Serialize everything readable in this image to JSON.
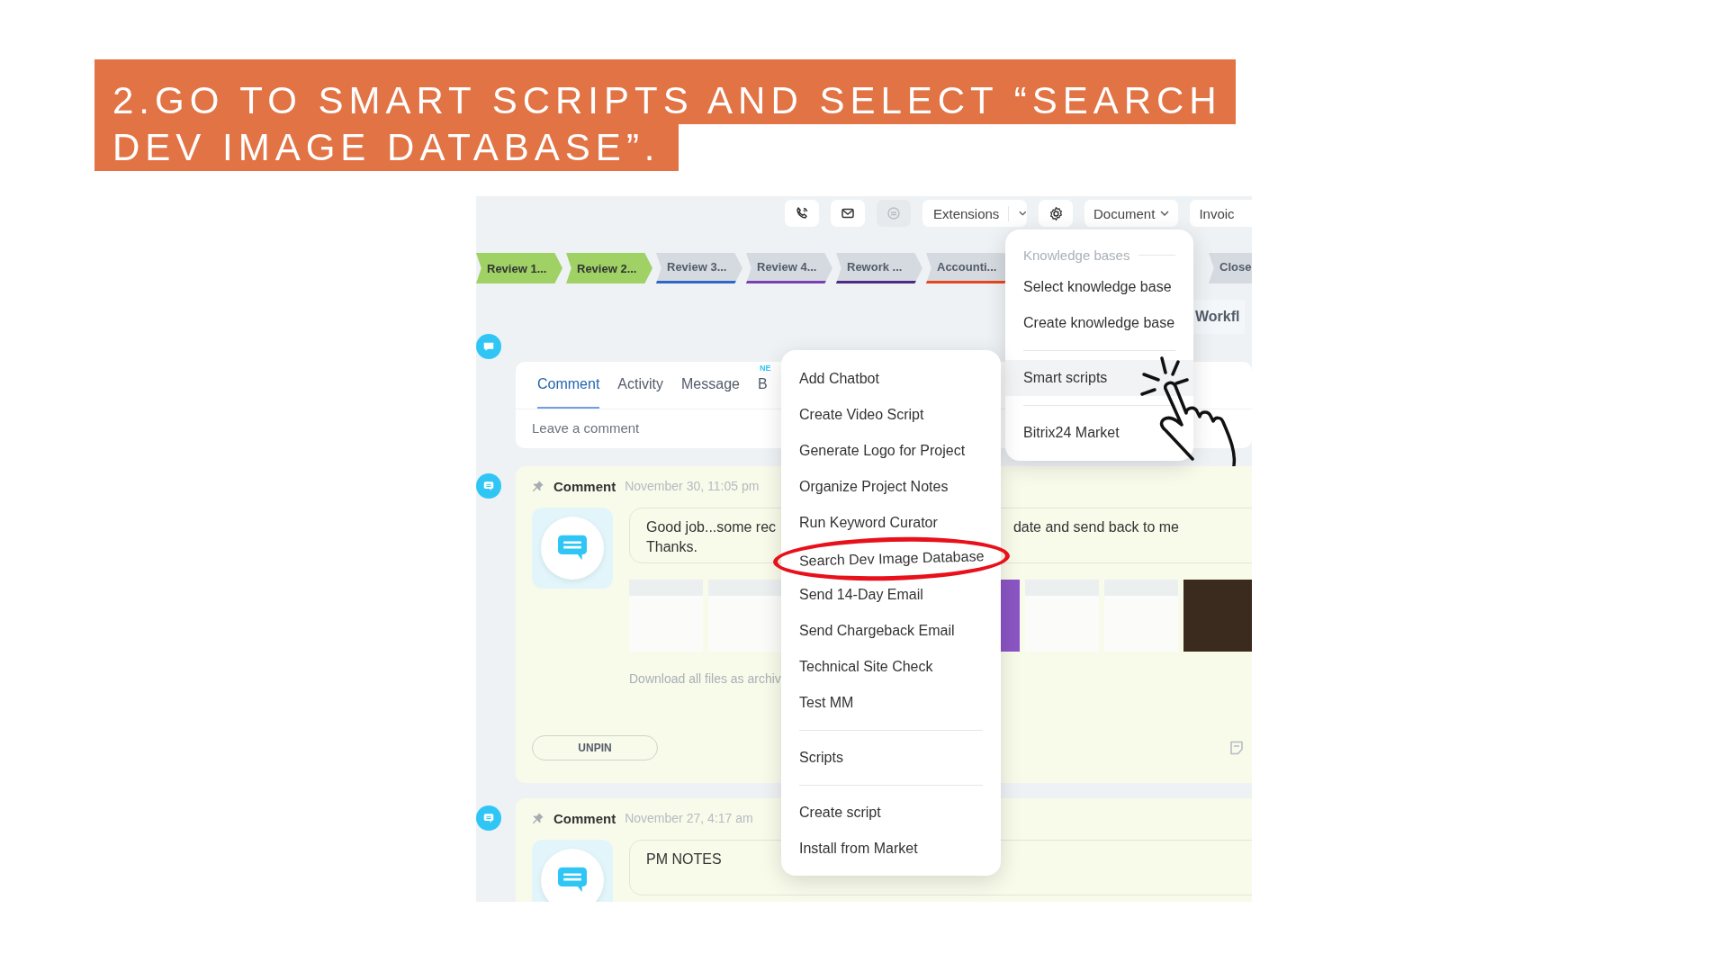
{
  "banner": {
    "lines": [
      "2.GO TO SMART SCRIPTS AND SELECT “SEARCH",
      "DEV IMAGE DATABASE”."
    ]
  },
  "toolbar": {
    "buttons": [
      {
        "kind": "phone",
        "disabled": false
      },
      {
        "kind": "mail",
        "disabled": false
      },
      {
        "kind": "chat",
        "disabled": true
      }
    ],
    "extensions": "Extensions",
    "document": "Document",
    "invoice": "Invoic"
  },
  "stages": [
    {
      "label": "Review 1...",
      "done": true,
      "color": "#9fd165"
    },
    {
      "label": "Review 2...",
      "done": true,
      "color": "#9fd165"
    },
    {
      "label": "Review 3...",
      "done": false,
      "color": "#2f66c9"
    },
    {
      "label": "Review 4...",
      "done": false,
      "color": "#7b3fb4"
    },
    {
      "label": "Rework ...",
      "done": false,
      "color": "#4e2a84"
    },
    {
      "label": "Accounti...",
      "done": false,
      "color": "#e8471d"
    },
    {
      "label": "Close",
      "done": false,
      "color": "#d5dae0"
    }
  ],
  "workflow_tab": "Workfl",
  "knowledge_menu": {
    "header": "Knowledge bases",
    "groups": [
      {
        "items": [
          {
            "label": "Select knowledge base",
            "selected": false
          },
          {
            "label": "Create knowledge base",
            "selected": false
          }
        ]
      },
      {
        "items": [
          {
            "label": "Smart scripts",
            "selected": true
          }
        ]
      },
      {
        "items": [
          {
            "label": "Bitrix24 Market",
            "selected": false
          }
        ]
      }
    ]
  },
  "composer": {
    "tabs": [
      {
        "label": "Comment",
        "selected": true
      },
      {
        "label": "Activity",
        "selected": false
      },
      {
        "label": "Message",
        "selected": false
      },
      {
        "label": "B",
        "selected": false,
        "badge": "NE"
      }
    ],
    "placeholder": "Leave a comment"
  },
  "cards": [
    {
      "title": "Comment",
      "date": "November 30, 11:05 pm",
      "message_lines": [
        "Good job...some rec",
        "Thanks."
      ],
      "message_right": "date and send back to me",
      "download": "Download all files as archiv",
      "unpin": "UNPIN"
    },
    {
      "title": "Comment",
      "date": "November 27, 4:17 am",
      "message_lines": [
        "PM NOTES"
      ]
    }
  ],
  "scripts_menu": {
    "groups": [
      {
        "items": [
          {
            "label": "Add Chatbot",
            "circled": false
          },
          {
            "label": "Create Video Script",
            "circled": false
          },
          {
            "label": "Generate Logo for Project",
            "circled": false
          },
          {
            "label": "Organize Project Notes",
            "circled": false
          },
          {
            "label": "Run Keyword Curator",
            "circled": false
          },
          {
            "label": "Search Dev Image Database",
            "circled": true
          },
          {
            "label": "Send 14-Day Email",
            "circled": false
          },
          {
            "label": "Send Chargeback Email",
            "circled": false
          },
          {
            "label": "Technical Site Check",
            "circled": false
          },
          {
            "label": "Test MM",
            "circled": false
          }
        ]
      },
      {
        "items": [
          {
            "label": "Scripts",
            "circled": false
          }
        ]
      },
      {
        "items": [
          {
            "label": "Create script",
            "circled": false
          },
          {
            "label": "Install from Market",
            "circled": false
          }
        ]
      }
    ]
  }
}
